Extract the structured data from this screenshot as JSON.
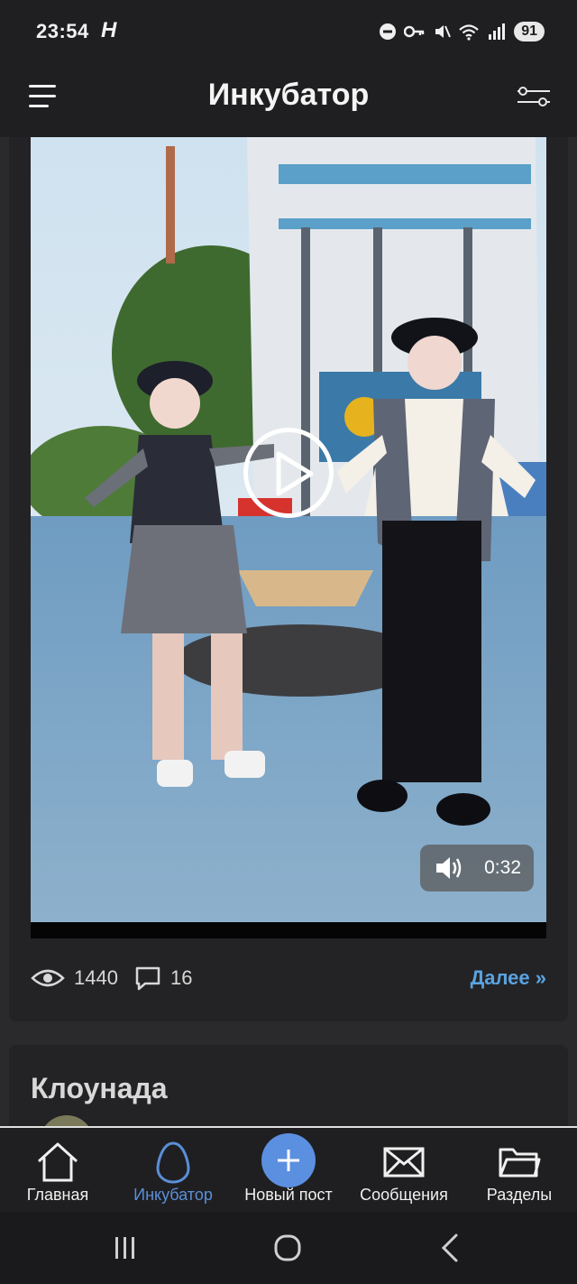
{
  "status_bar": {
    "time": "23:54",
    "carrier_icon": "H",
    "icons": [
      "do-not-disturb-icon",
      "key-icon",
      "mute-icon",
      "wifi-icon",
      "signal-icon"
    ],
    "battery": "91"
  },
  "header": {
    "title": "Инкубатор",
    "menu_icon": "hamburger-menu-icon",
    "filter_icon": "filter-sliders-icon"
  },
  "post": {
    "video_duration": "0:32",
    "views": "1440",
    "comments": "16",
    "more_link": "Далее »"
  },
  "next_post": {
    "title": "Клоунада"
  },
  "bottom_nav": {
    "items": [
      {
        "label": "Главная",
        "icon": "home-icon"
      },
      {
        "label": "Инкубатор",
        "icon": "egg-icon"
      },
      {
        "label": "Новый пост",
        "icon": "plus-icon"
      },
      {
        "label": "Сообщения",
        "icon": "envelope-icon"
      },
      {
        "label": "Разделы",
        "icon": "folder-icon"
      }
    ],
    "active_index": 1
  },
  "colors": {
    "accent": "#5a8fd8",
    "link": "#5aa3e0",
    "background": "#2a2a2c"
  }
}
